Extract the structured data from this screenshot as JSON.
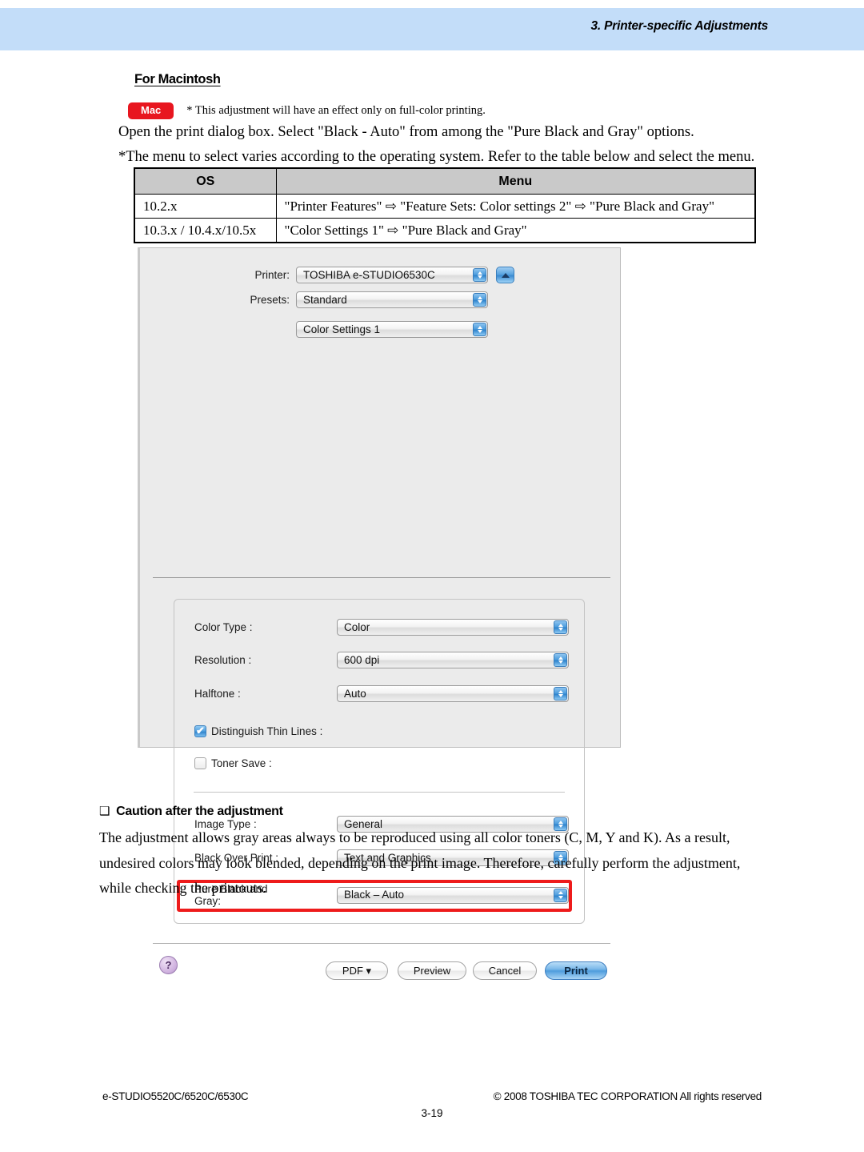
{
  "header": {
    "title": "3. Printer-specific Adjustments",
    "band_color": "#c3ddf9"
  },
  "section": {
    "heading": "For Macintosh",
    "badge_label": "Mac",
    "badge_color": "#e8161f",
    "badge_note": "* This adjustment will have an effect only on full-color printing.",
    "lead_line_1": "Open the print dialog box.  Select \"Black - Auto\" from among the \"Pure Black and Gray\" options.",
    "lead_line_2": "*The menu to select varies according to the operating system.  Refer to the table below and select the menu."
  },
  "os_table": {
    "headers": [
      "OS",
      "Menu"
    ],
    "rows": [
      {
        "os": "10.2.x",
        "menu": "\"Printer Features\" ⇨ \"Feature Sets: Color settings 2\" ⇨ \"Pure Black and Gray\""
      },
      {
        "os": "10.3.x / 10.4.x/10.5x",
        "menu": "\"Color Settings 1\" ⇨ \"Pure Black and Gray\""
      }
    ]
  },
  "print_dialog": {
    "printer_label": "Printer:",
    "printer_value": "TOSHIBA e-STUDIO6530C",
    "presets_label": "Presets:",
    "presets_value": "Standard",
    "pane_value": "Color Settings 1",
    "settings": [
      {
        "label": "Color Type :",
        "value": "Color"
      },
      {
        "label": "Resolution :",
        "value": "600 dpi"
      },
      {
        "label": "Halftone :",
        "value": "Auto"
      }
    ],
    "checkboxes": [
      {
        "label": "Distinguish Thin Lines :",
        "checked": "checked",
        "mark": "✔"
      },
      {
        "label": "Toner Save :",
        "checked": "unchecked",
        "mark": ""
      }
    ],
    "settings2": [
      {
        "label": "Image Type :",
        "value": "General"
      },
      {
        "label": "Black Over Print :",
        "value": "Text and Graphics"
      },
      {
        "label": "Pure Black and Gray:",
        "value": "Black – Auto"
      }
    ],
    "highlight_color": "#ee1b1b",
    "buttons": {
      "help": "?",
      "pdf": "PDF ▾",
      "preview": "Preview",
      "cancel": "Cancel",
      "print": "Print"
    }
  },
  "caution": {
    "bullet": "❑",
    "heading": "Caution after the adjustment",
    "line_1": "The adjustment allows gray areas always to be reproduced using all color toners (C, M, Y and K).  As a result,",
    "line_2": "undesired colors may look blended, depending on the print image.  Therefore, carefully perform the adjustment,",
    "line_3": "while checking the printouts."
  },
  "footer": {
    "left": "e-STUDIO5520C/6520C/6530C",
    "right": "© 2008 TOSHIBA TEC CORPORATION All rights reserved",
    "page": "3-19"
  }
}
